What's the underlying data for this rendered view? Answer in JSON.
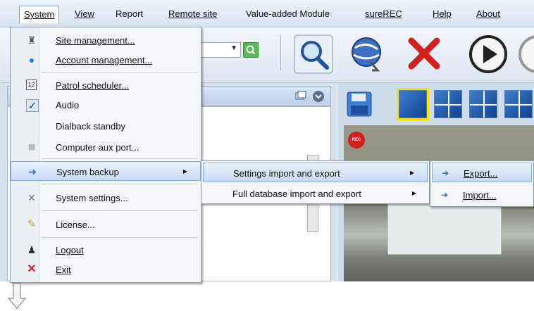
{
  "menubar": {
    "items": [
      "System",
      "View",
      "Report",
      "Remote site",
      "Value-added Module",
      "sureREC",
      "Help",
      "About"
    ]
  },
  "system_menu": {
    "items": [
      {
        "label": "Site management...",
        "icon": "site-icon"
      },
      {
        "label": "Account management...",
        "icon": "user-icon"
      },
      {
        "label": "Patrol scheduler...",
        "icon": "calendar-icon"
      },
      {
        "label": "Audio",
        "icon": "check-icon"
      },
      {
        "label": "Dialback standby",
        "icon": ""
      },
      {
        "label": "Computer aux port...",
        "icon": "port-icon"
      },
      {
        "label": "System backup",
        "icon": "backup-icon"
      },
      {
        "label": "System settings...",
        "icon": "tools-icon"
      },
      {
        "label": "License...",
        "icon": "key-icon"
      },
      {
        "label": "Logout",
        "icon": "logout-icon"
      },
      {
        "label": "Exit",
        "icon": "close-icon"
      }
    ]
  },
  "backup_submenu": {
    "items": [
      "Settings import and export",
      "Full database import and export"
    ]
  },
  "settings_submenu": {
    "items": [
      "Export...",
      "Import..."
    ]
  },
  "rec_badge": "REC",
  "colors": {
    "menu_highlight": "#c8dcf5",
    "exit_red": "#d3201f",
    "layout_selected": "#f5e400",
    "toolbar_bg": "#dde6f1"
  }
}
